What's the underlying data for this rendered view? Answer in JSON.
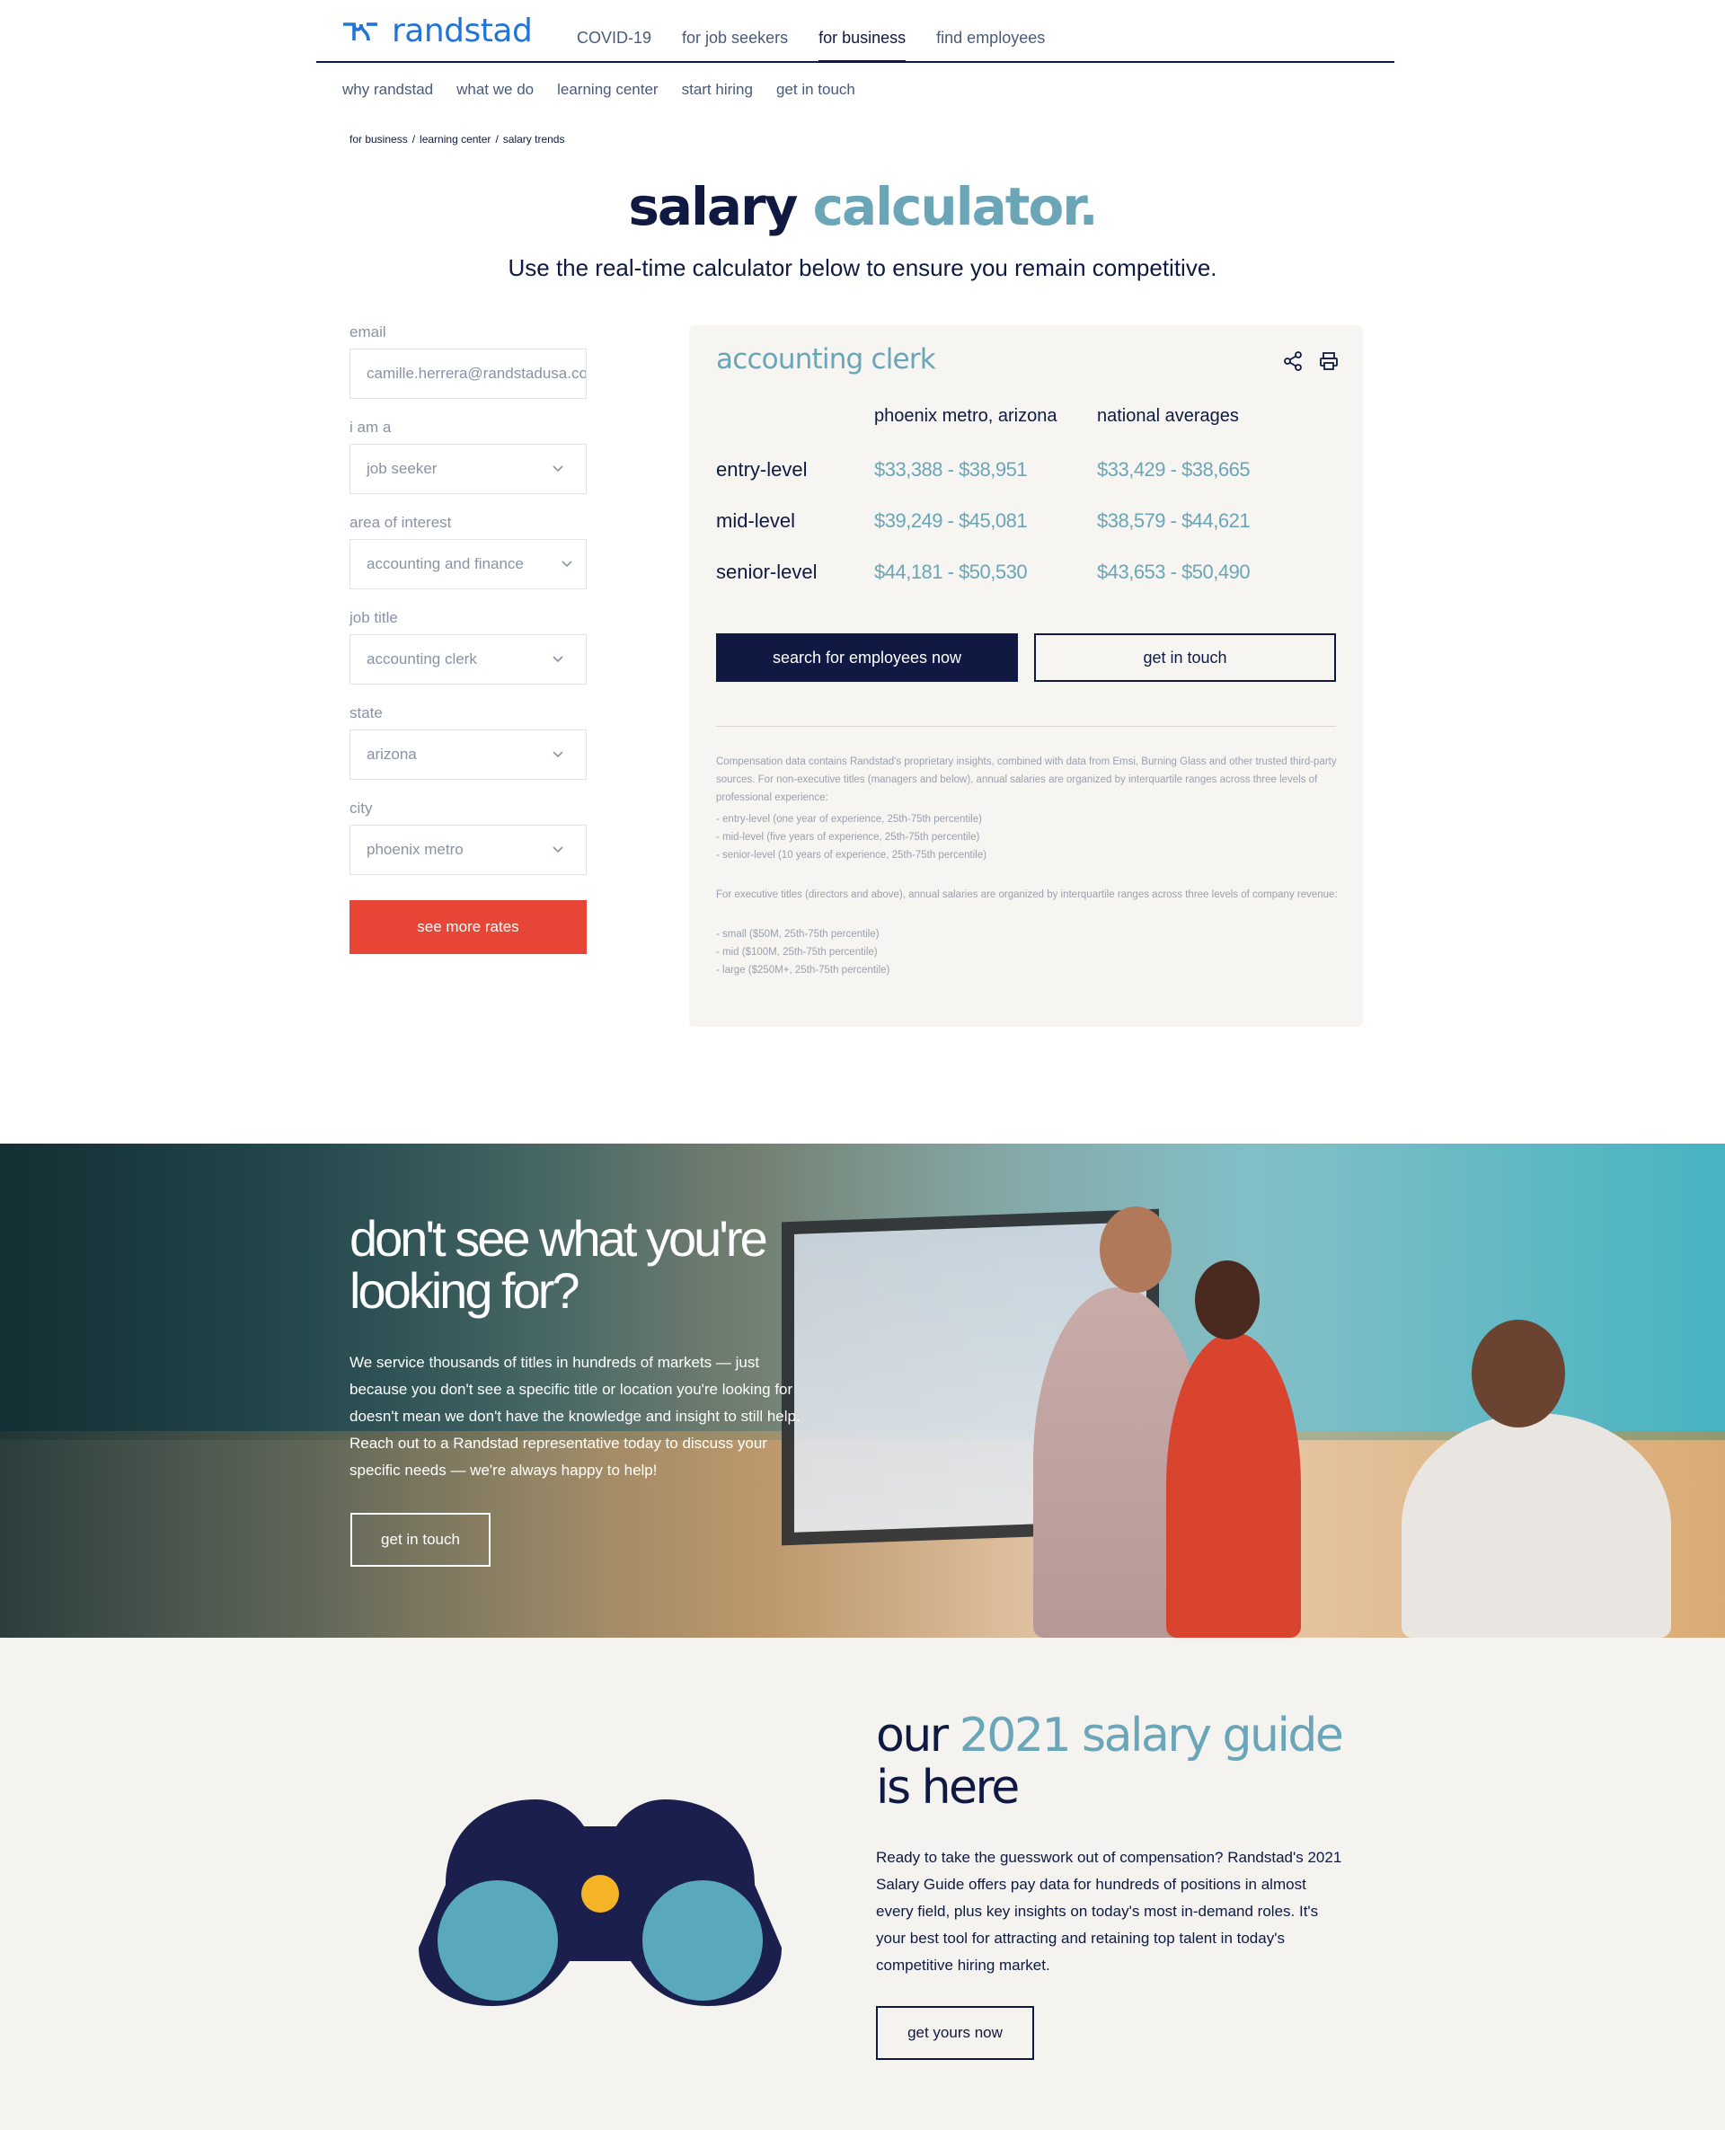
{
  "brand": {
    "name": "randstad",
    "color": "#2175d9"
  },
  "main_nav": [
    {
      "label": "COVID-19",
      "active": false
    },
    {
      "label": "for job seekers",
      "active": false
    },
    {
      "label": "for business",
      "active": true
    },
    {
      "label": "find employees",
      "active": false
    }
  ],
  "sub_nav": [
    "why randstad",
    "what we do",
    "learning center",
    "start hiring",
    "get in touch"
  ],
  "breadcrumb": [
    "for business",
    "/",
    "learning center",
    "/",
    "salary trends"
  ],
  "hero": {
    "title_main": "salary ",
    "title_accent": "calculator.",
    "subtitle": "Use the real-time calculator below to ensure you remain competitive."
  },
  "form": {
    "email_label": "email",
    "email_value": "camille.herrera@randstadusa.com",
    "role_label": "i am a",
    "role_value": "job seeker",
    "area_label": "area of interest",
    "area_value": "accounting and finance",
    "title_label": "job title",
    "title_value": "accounting clerk",
    "state_label": "state",
    "state_value": "arizona",
    "city_label": "city",
    "city_value": "phoenix metro",
    "submit_label": "see more rates"
  },
  "results": {
    "job_title": "accounting clerk",
    "columns": [
      "phoenix metro, arizona",
      "national averages"
    ],
    "rows": [
      {
        "level": "entry-level",
        "local": "$33,388 - $38,951",
        "national": "$33,429 - $38,665"
      },
      {
        "level": "mid-level",
        "local": "$39,249 - $45,081",
        "national": "$38,579 - $44,621"
      },
      {
        "level": "senior-level",
        "local": "$44,181 - $50,530",
        "national": "$43,653 - $50,490"
      }
    ],
    "primary_button": "search for employees now",
    "secondary_button": "get in touch",
    "fine_intro": "Compensation data contains Randstad's proprietary insights, combined with data from Emsi, Burning Glass and other trusted third-party sources. For non-executive titles (managers and below), annual salaries are organized by interquartile ranges across three levels of professional experience:",
    "fine_levels": [
      "- entry-level (one year of experience, 25th-75th percentile)",
      "- mid-level (five years of experience, 25th-75th percentile)",
      "- senior-level (10 years of experience, 25th-75th percentile)"
    ],
    "fine_exec": "For executive titles (directors and above), annual salaries are organized by interquartile ranges across three levels of company revenue:",
    "fine_sizes": [
      "- small ($50M, 25th-75th percentile)",
      "- mid ($100M, 25th-75th percentile)",
      "- large ($250M+, 25th-75th percentile)"
    ]
  },
  "banner": {
    "heading": "don't see what you're looking for?",
    "body": "We service thousands of titles in hundreds of markets — just because you don't see a specific title or location you're looking for doesn't mean we don't have the knowledge and insight to still help. Reach out to a Randstad representative today to discuss your specific needs — we're always happy to help!",
    "button": "get in touch"
  },
  "guide": {
    "heading_main": "our ",
    "heading_accent": "2021 salary guide",
    "heading_end": " is here",
    "body": "Ready to take the guesswork out of compensation? Randstad's 2021 Salary Guide offers pay data for hundreds of positions in almost every field, plus key insights on today's most in-demand roles. It's your best tool for attracting and retaining top talent in today's competitive hiring market.",
    "button": "get yours now"
  },
  "colors": {
    "navy": "#0f1941",
    "accent_teal": "#6aa5b8",
    "cta_red": "#e74536",
    "card_bg": "#f6f5f1",
    "binocular_lens": "#5aa8bd",
    "binocular_center": "#f5b326"
  }
}
